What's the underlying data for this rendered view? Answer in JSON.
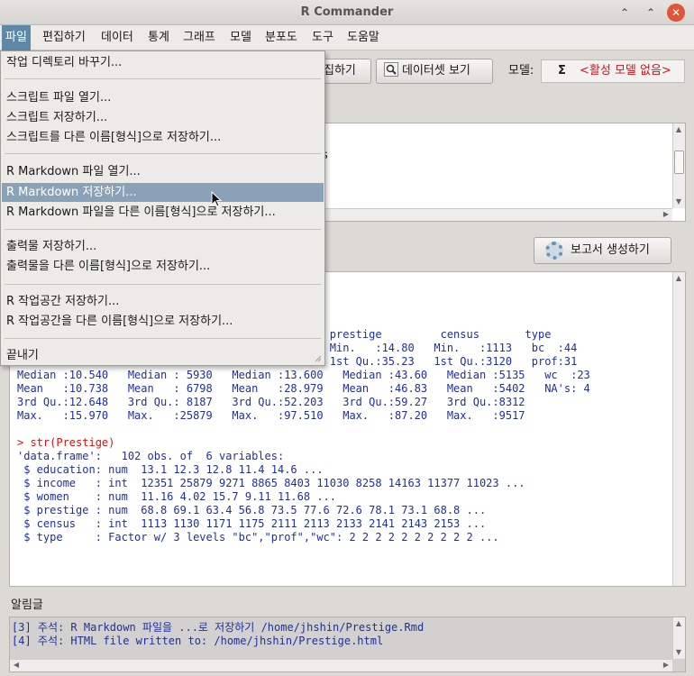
{
  "window": {
    "title": "R Commander",
    "min_glyph": "⌃",
    "max_glyph": "⌃",
    "close_glyph": "✕"
  },
  "menubar": [
    "파일",
    "편집하기",
    "데이터",
    "통계",
    "그래프",
    "모델",
    "분포도",
    "도구",
    "도움말"
  ],
  "toolbar": {
    "edit_partial": "집하기",
    "view_dataset": "데이터셋 보기",
    "model_label": "모델:",
    "model_sigma": "Σ",
    "model_value": "<활성 모델 없음>"
  },
  "script_partial": "s",
  "report_button": "보고서 생성하기",
  "file_menu": {
    "items": [
      "작업 디렉토리 바꾸기...",
      "스크립트 파일 열기...",
      "스크립트 저장하기...",
      "스크립트를 다른 이름[형식]으로 저장하기...",
      "R Markdown 파일 열기...",
      "R Markdown 저장하기...",
      "R Markdown 파일을 다른 이름[형식]으로 저장하기...",
      "출력물 저장하기...",
      "출력물을 다른 이름[형식]으로 저장하기...",
      "R 작업공간 저장하기...",
      "R 작업공간을 다른 이름[형식]으로 저장하기...",
      "끝내기"
    ],
    "highlighted_index": 5
  },
  "output": {
    "summary_partial": [
      "                                                prestige         census       type",
      "                                                Min.   :14.80   Min.   :1113   bc  :44",
      "                                                1st Qu.:35.23   1st Qu.:3120   prof:31",
      "Median :10.540   Median : 5930   Median :13.600   Median :43.60   Median :5135   wc  :23",
      "Mean   :10.738   Mean   : 6798   Mean   :28.979   Mean   :46.83   Mean   :5402   NA's: 4",
      "3rd Qu.:12.648   3rd Qu.: 8187   3rd Qu.:52.203   3rd Qu.:59.27   3rd Qu.:8312",
      "Max.   :15.970   Max.   :25879   Max.   :97.510   Max.   :87.20   Max.   :9517"
    ],
    "command": "> str(Prestige)",
    "str_lines": [
      "'data.frame':\t102 obs. of  6 variables:",
      " $ education: num  13.1 12.3 12.8 11.4 14.6 ...",
      " $ income   : int  12351 25879 9271 8865 8403 11030 8258 14163 11377 11023 ...",
      " $ women    : num  11.16 4.02 15.7 9.11 11.68 ...",
      " $ prestige : num  68.8 69.1 63.4 56.8 73.5 77.6 72.6 78.1 73.1 68.8 ...",
      " $ census   : int  1113 1130 1171 1175 2111 2113 2133 2141 2143 2153 ...",
      " $ type     : Factor w/ 3 levels \"bc\",\"prof\",\"wc\": 2 2 2 2 2 2 2 2 2 2 ..."
    ]
  },
  "messages": {
    "label": "알림글",
    "lines": [
      "[3] 주석: R Markdown 파일을 ...로 저장하기 /home/jhshin/Prestige.Rmd",
      "[4] 주석: HTML file written to: /home/jhshin/Prestige.html"
    ]
  },
  "colors": {
    "accent": "#5e87a8",
    "output_text": "#1f2f9e",
    "prompt": "#cc1414",
    "model_text": "#d0141c"
  }
}
